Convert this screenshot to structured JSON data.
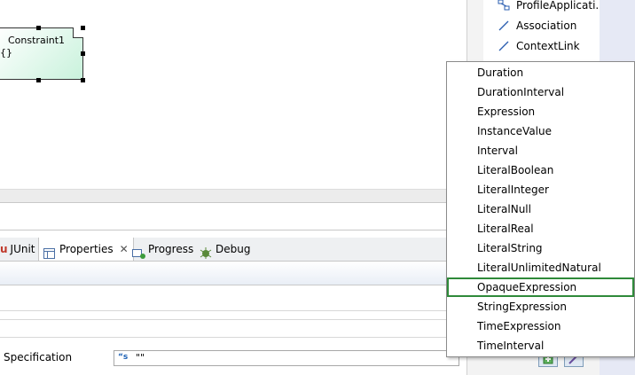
{
  "diagram": {
    "constraint_name": "Constraint1",
    "constraint_spec": "{}"
  },
  "palette": {
    "items": [
      {
        "label": "ProfileApplicati...",
        "icon": "profile-application-icon"
      },
      {
        "label": "Association",
        "icon": "association-line-icon"
      },
      {
        "label": "ContextLink",
        "icon": "context-link-line-icon"
      }
    ]
  },
  "views": {
    "tabs": [
      {
        "label": "JUnit",
        "icon": "junit-icon"
      },
      {
        "label": "Properties",
        "icon": "properties-icon",
        "active": true
      },
      {
        "label": "Progress",
        "icon": "progress-icon"
      },
      {
        "label": "Debug",
        "icon": "debug-icon"
      }
    ]
  },
  "properties": {
    "specification_label": "Specification",
    "specification_value": "\"\""
  },
  "menu": {
    "items": [
      "Duration",
      "DurationInterval",
      "Expression",
      "InstanceValue",
      "Interval",
      "LiteralBoolean",
      "LiteralInteger",
      "LiteralNull",
      "LiteralReal",
      "LiteralString",
      "LiteralUnlimitedNatural",
      "OpaqueExpression",
      "StringExpression",
      "TimeExpression",
      "TimeInterval"
    ],
    "selected": "OpaqueExpression",
    "selected_color": "#2f8a3a"
  }
}
